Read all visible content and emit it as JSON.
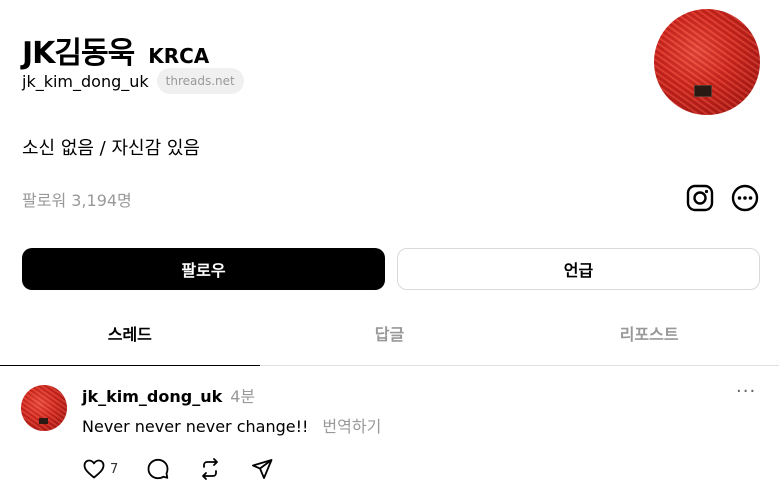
{
  "profile": {
    "name": "JK김동욱",
    "tag": "KRCA",
    "handle": "jk_kim_dong_uk",
    "domain": "threads.net",
    "bio": "소신 없음 / 자신감 있음",
    "followers": "팔로워 3,194명"
  },
  "buttons": {
    "follow": "팔로우",
    "mention": "언급"
  },
  "tabs": [
    {
      "label": "스레드",
      "active": true
    },
    {
      "label": "답글",
      "active": false
    },
    {
      "label": "리포스트",
      "active": false
    }
  ],
  "post": {
    "author": "jk_kim_dong_uk",
    "time": "4분",
    "text": "Never never never change!!",
    "translate": "번역하기",
    "like_count": "7",
    "more": "···"
  },
  "icons": {
    "instagram": "instagram-icon",
    "more_options": "more-options-icon",
    "like": "heart-icon",
    "comment": "comment-icon",
    "repost": "repost-icon",
    "share": "share-icon"
  },
  "colors": {
    "primary_button": "#000000",
    "muted_text": "#999999",
    "avatar_red": "#d42a20"
  }
}
